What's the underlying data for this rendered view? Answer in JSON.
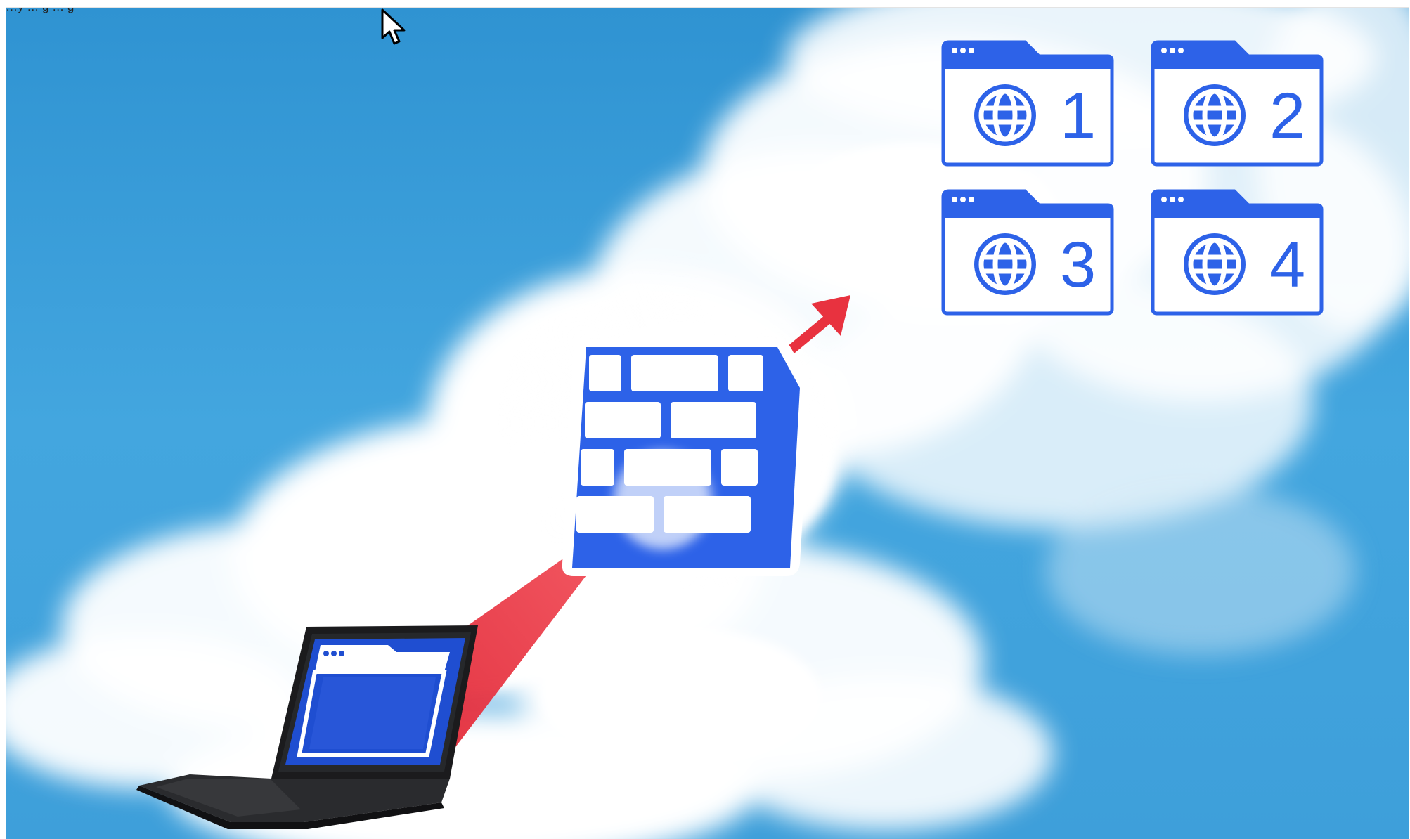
{
  "caption": {
    "text": "…y … g … g"
  },
  "colors": {
    "sky_top": "#2f95d3",
    "sky_bottom": "#4eaee4",
    "cloud": "#ffffff",
    "icon_blue": "#2d62e8",
    "beam_red": "#e8323f",
    "laptop_screen": "#1f4ed1"
  },
  "websites": [
    {
      "number": "1",
      "icon": "globe-icon"
    },
    {
      "number": "2",
      "icon": "globe-icon"
    },
    {
      "number": "3",
      "icon": "globe-icon"
    },
    {
      "number": "4",
      "icon": "globe-icon"
    }
  ],
  "icons": {
    "firewall": "brick-wall-icon",
    "arrow": "arrow-up-right-icon",
    "laptop": "laptop-icon",
    "cursor": "mouse-pointer-icon"
  }
}
